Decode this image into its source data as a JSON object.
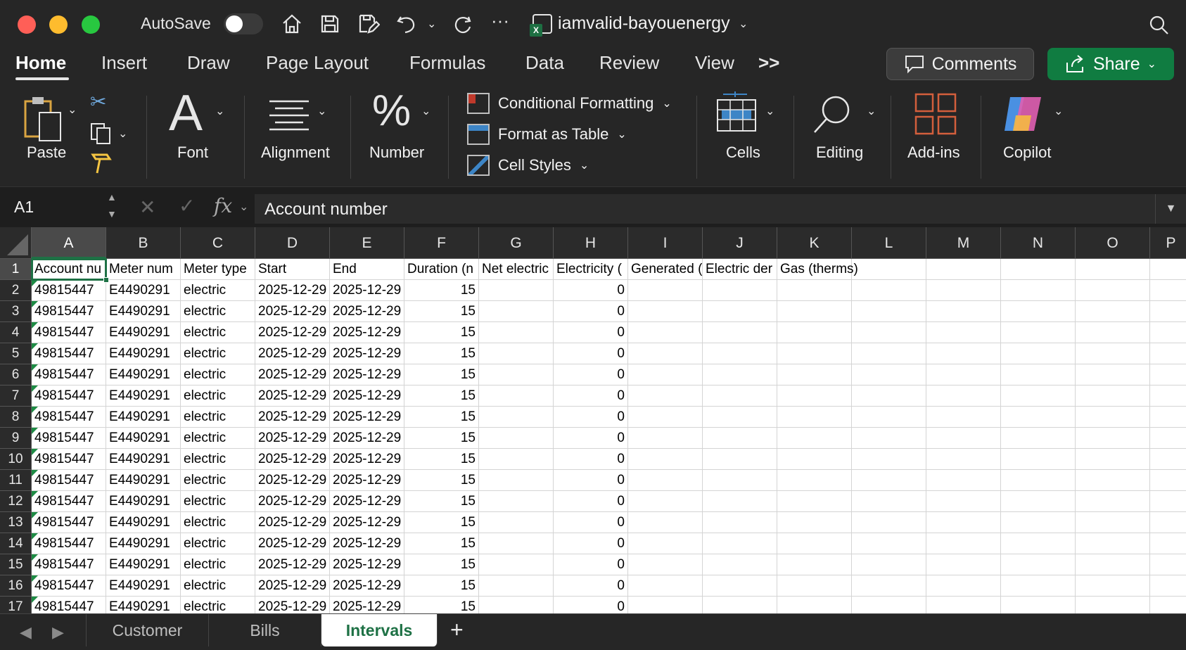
{
  "titlebar": {
    "autosave_label": "AutoSave",
    "doc_title": "iamvalid-bayouenergy"
  },
  "ribbon_tabs": [
    "Home",
    "Insert",
    "Draw",
    "Page Layout",
    "Formulas",
    "Data",
    "Review",
    "View"
  ],
  "ribbon_more": ">>",
  "buttons": {
    "comments": "Comments",
    "share": "Share"
  },
  "ribbon": {
    "paste": "Paste",
    "font": "Font",
    "alignment": "Alignment",
    "number": "Number",
    "conditional_formatting": "Conditional Formatting",
    "format_as_table": "Format as Table",
    "cell_styles": "Cell Styles",
    "cells": "Cells",
    "editing": "Editing",
    "addins": "Add-ins",
    "copilot": "Copilot"
  },
  "formula_bar": {
    "name_box": "A1",
    "fx": "fx",
    "value": "Account number"
  },
  "columns": [
    "A",
    "B",
    "C",
    "D",
    "E",
    "F",
    "G",
    "H",
    "I",
    "J",
    "K",
    "L",
    "M",
    "N",
    "O",
    "P"
  ],
  "headers": [
    "Account nu",
    "Meter num",
    "Meter type",
    "Start",
    "End",
    "Duration (n",
    "Net electric",
    "Electricity (",
    "Generated (",
    "Electric der",
    "Gas (therms)"
  ],
  "row_numbers": [
    "1",
    "2",
    "3",
    "4",
    "5",
    "6",
    "7",
    "8",
    "9",
    "10",
    "11",
    "12",
    "13",
    "14",
    "15",
    "16",
    "17"
  ],
  "row_template": {
    "account": "49815447",
    "meter": "E4490291",
    "type": "electric",
    "start": "2025-12-29",
    "end": "2025-12-29",
    "duration": "15",
    "electricity": "0"
  },
  "sheet_tabs": [
    "Customer",
    "Bills",
    "Intervals"
  ],
  "active_sheet": "Intervals",
  "colors": {
    "excel_green": "#1e7145",
    "share_green": "#107c41"
  }
}
